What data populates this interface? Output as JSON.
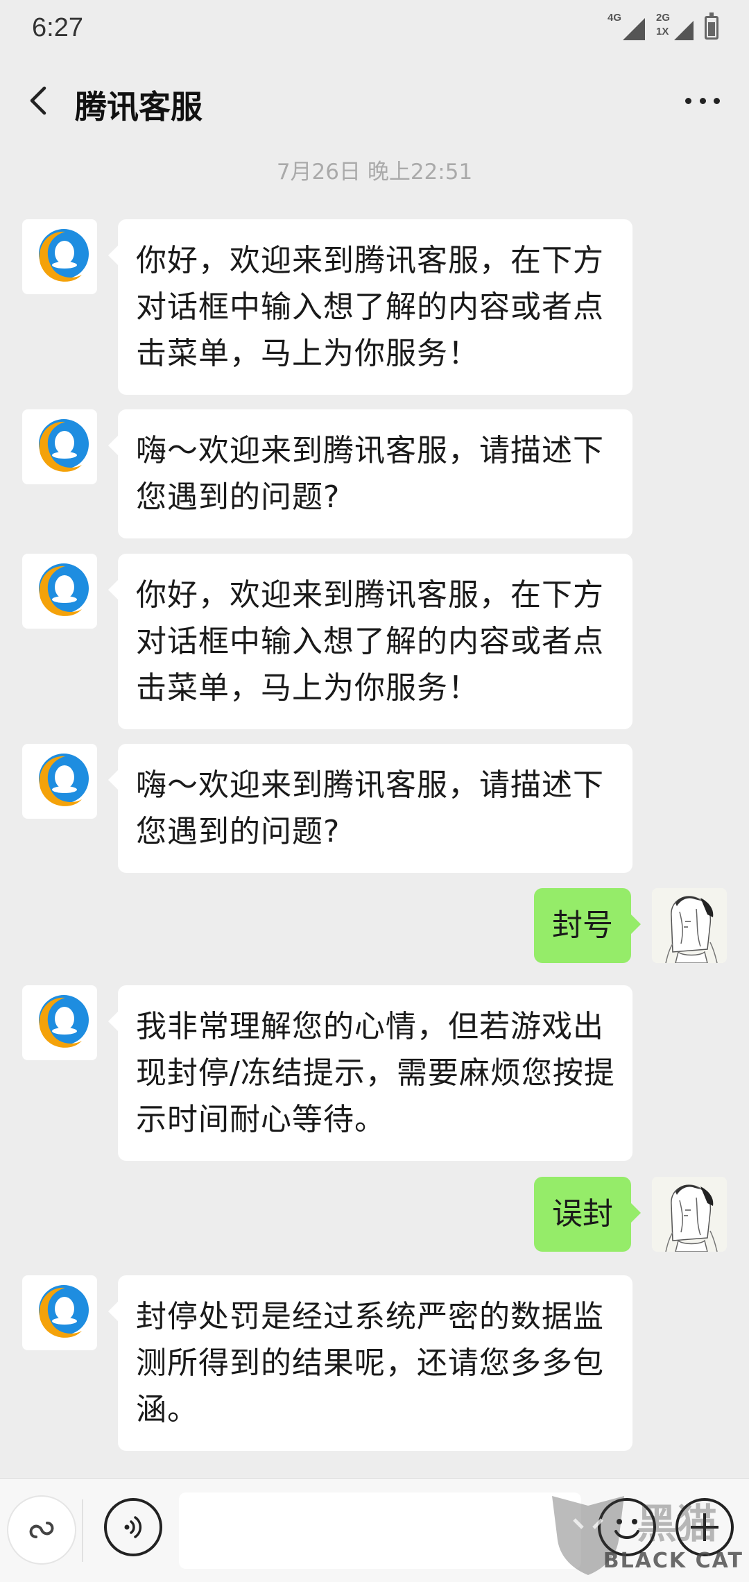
{
  "status_bar": {
    "time": "6:27",
    "signal1_label": "4G",
    "signal2_label_top": "2G",
    "signal2_label_bottom": "1X"
  },
  "header": {
    "title": "腾讯客服"
  },
  "chat": {
    "timestamp": "7月26日 晚上22:51",
    "messages": [
      {
        "side": "in",
        "text": "你好，欢迎来到腾讯客服，在下方对话框中输入想了解的内容或者点击菜单，马上为你服务！"
      },
      {
        "side": "in",
        "text": "嗨～欢迎来到腾讯客服，请描述下您遇到的问题?"
      },
      {
        "side": "in",
        "text": "你好，欢迎来到腾讯客服，在下方对话框中输入想了解的内容或者点击菜单，马上为你服务！"
      },
      {
        "side": "in",
        "text": "嗨～欢迎来到腾讯客服，请描述下您遇到的问题?"
      },
      {
        "side": "out",
        "text": "封号"
      },
      {
        "side": "in",
        "text": "我非常理解您的心情，但若游戏出现封停/冻结提示，需要麻烦您按提示时间耐心等待。"
      },
      {
        "side": "out",
        "text": "误封"
      },
      {
        "side": "in",
        "text": "封停处罚是经过系统严密的数据监测所得到的结果呢，还请您多多包涵。"
      }
    ]
  },
  "input_bar": {
    "text_value": "",
    "watermark": "BLACK CAT"
  },
  "colors": {
    "background": "#ededed",
    "outgoing_bubble": "#95ec69",
    "incoming_bubble": "#ffffff",
    "avatar_blue": "#1e8de0",
    "avatar_orange": "#f4a20a"
  },
  "icons": [
    "back-arrow-icon",
    "more-dots-icon",
    "mini-program-icon",
    "voice-icon",
    "emoji-icon",
    "plus-icon"
  ]
}
